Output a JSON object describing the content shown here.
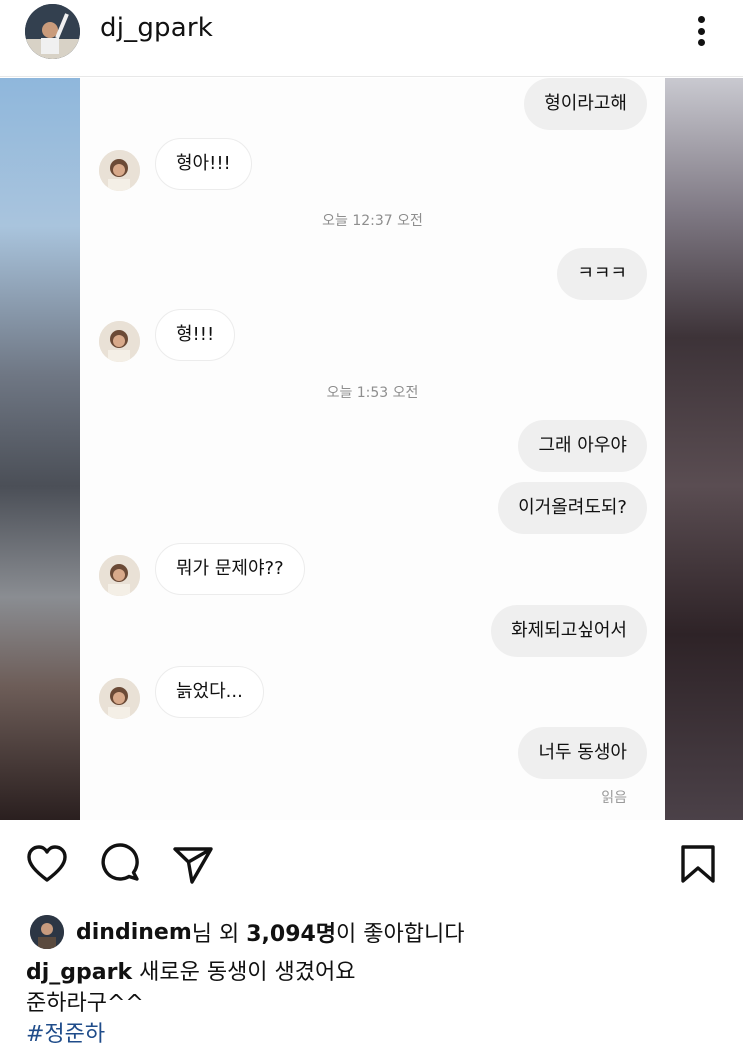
{
  "header": {
    "username": "dj_gpark"
  },
  "chat": {
    "messages": [
      {
        "side": "mine",
        "text": "형이라고해"
      },
      {
        "side": "theirs",
        "text": "형아!!!"
      },
      {
        "side": "time",
        "text": "오늘 12:37 오전"
      },
      {
        "side": "mine",
        "text": "ㅋㅋㅋ"
      },
      {
        "side": "theirs",
        "text": "형!!!"
      },
      {
        "side": "time",
        "text": "오늘 1:53 오전"
      },
      {
        "side": "mine",
        "text": "그래 아우야"
      },
      {
        "side": "mine",
        "text": "이거올려도되?"
      },
      {
        "side": "theirs",
        "text": "뭐가 문제야??"
      },
      {
        "side": "mine",
        "text": "화제되고싶어서"
      },
      {
        "side": "theirs",
        "text": "늙었다..."
      },
      {
        "side": "mine",
        "text": "너두 동생아"
      }
    ],
    "read_receipt": "읽음"
  },
  "actions": {
    "icons": [
      "heart-icon",
      "comment-icon",
      "share-icon",
      "bookmark-icon"
    ]
  },
  "likes": {
    "user": "dindinem",
    "suffix_1": "님 외 ",
    "count": "3,094명",
    "suffix_2": "이 좋아합니다"
  },
  "caption": {
    "username": "dj_gpark",
    "line1": " 새로운 동생이 생겼어요",
    "line2": "준하라구^^",
    "hashtag": "#정준하"
  }
}
